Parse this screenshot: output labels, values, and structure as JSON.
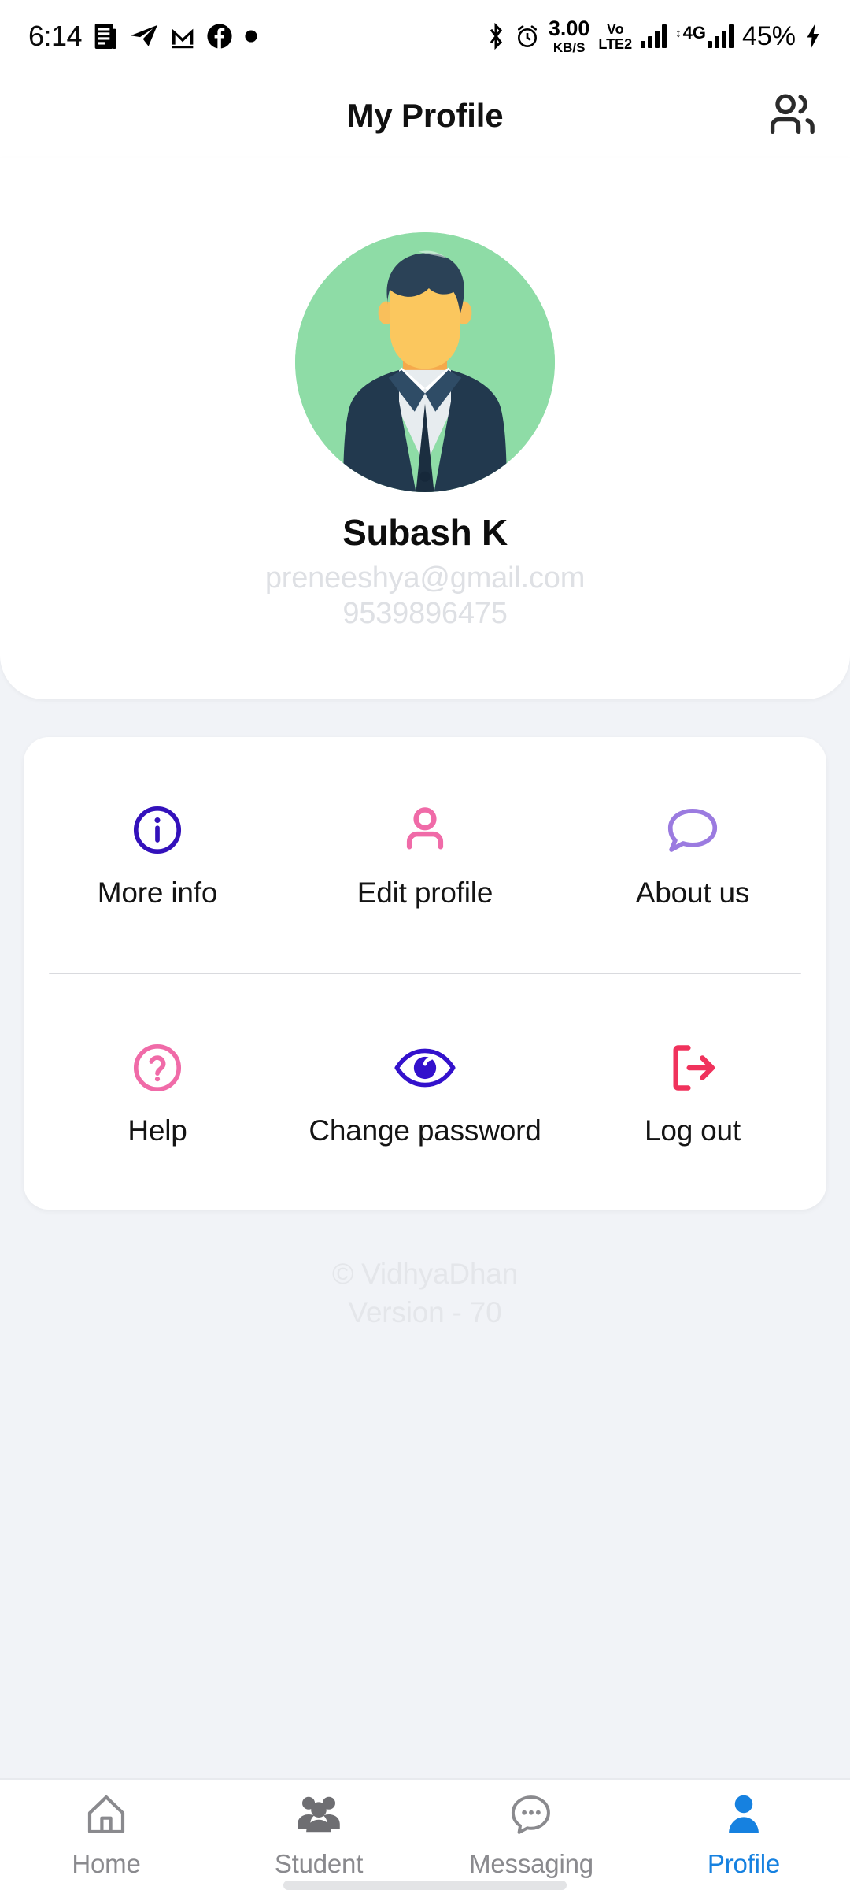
{
  "status_bar": {
    "time": "6:14",
    "notification_icons": [
      "news-icon",
      "telegram-icon",
      "gmail-icon",
      "facebook-icon",
      "dot-icon"
    ],
    "bluetooth_icon": "bluetooth-icon",
    "alarm_icon": "alarm-icon",
    "network_speed_value": "3.00",
    "network_speed_unit": "KB/S",
    "volte_top": "Vo",
    "volte_bottom": "LTE2",
    "network_type": "4G",
    "battery_percent": "45%",
    "charging_icon": "charging-bolt-icon"
  },
  "appbar": {
    "title": "My Profile",
    "action_icon": "users-icon"
  },
  "profile": {
    "avatar_icon": "user-avatar-illustration",
    "avatar_bg_color": "#8EDCA6",
    "name": "Subash K",
    "email": "preneeshya@gmail.com",
    "phone": "9539896475"
  },
  "actions": {
    "rows": [
      [
        {
          "label": "More info",
          "icon": "info-circle-icon",
          "color": "#3311BB"
        },
        {
          "label": "Edit profile",
          "icon": "person-outline-icon",
          "color": "#F06BA8"
        },
        {
          "label": "About us",
          "icon": "speech-bubble-icon",
          "color": "#9B7BE0"
        }
      ],
      [
        {
          "label": "Help",
          "icon": "question-circle-icon",
          "color": "#F06BA8"
        },
        {
          "label": "Change password",
          "icon": "eye-icon",
          "color": "#3311CC"
        },
        {
          "label": "Log out",
          "icon": "logout-arrow-icon",
          "color": "#F0325C"
        }
      ]
    ]
  },
  "footer": {
    "copyright": "© VidhyaDhan",
    "version": "Version - 70"
  },
  "bottom_nav": {
    "active_color": "#1681E0",
    "items": [
      {
        "label": "Home",
        "icon": "home-icon",
        "active": false
      },
      {
        "label": "Student",
        "icon": "group-icon",
        "active": false
      },
      {
        "label": "Messaging",
        "icon": "chat-dots-icon",
        "active": false
      },
      {
        "label": "Profile",
        "icon": "person-icon",
        "active": true
      }
    ]
  }
}
